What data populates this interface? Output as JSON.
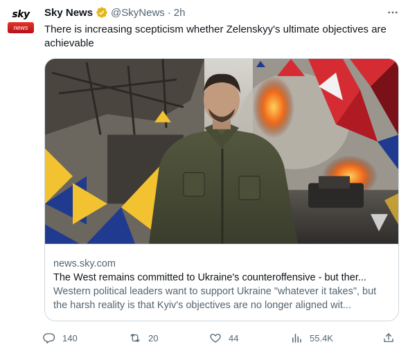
{
  "tweet": {
    "author_name": "Sky News",
    "handle": "@SkyNews",
    "separator": "·",
    "time": "2h",
    "text": "There is increasing scepticism whether Zelenskyy's ultimate objectives are achievable",
    "avatar": {
      "top": "sky",
      "bottom": "news"
    },
    "verified_badge_color": "#e2b719"
  },
  "card": {
    "domain": "news.sky.com",
    "title": "The West remains committed to Ukraine's counteroffensive - but ther...",
    "description": "Western political leaders want to support Ukraine \"whatever it takes\", but the harsh reality is that Kyiv's objectives are no longer aligned wit..."
  },
  "actions": {
    "reply_count": "140",
    "retweet_count": "20",
    "like_count": "44",
    "view_count": "55.4K"
  },
  "colors": {
    "text_primary": "#0f1419",
    "text_secondary": "#536471",
    "border": "#cfd9de"
  }
}
